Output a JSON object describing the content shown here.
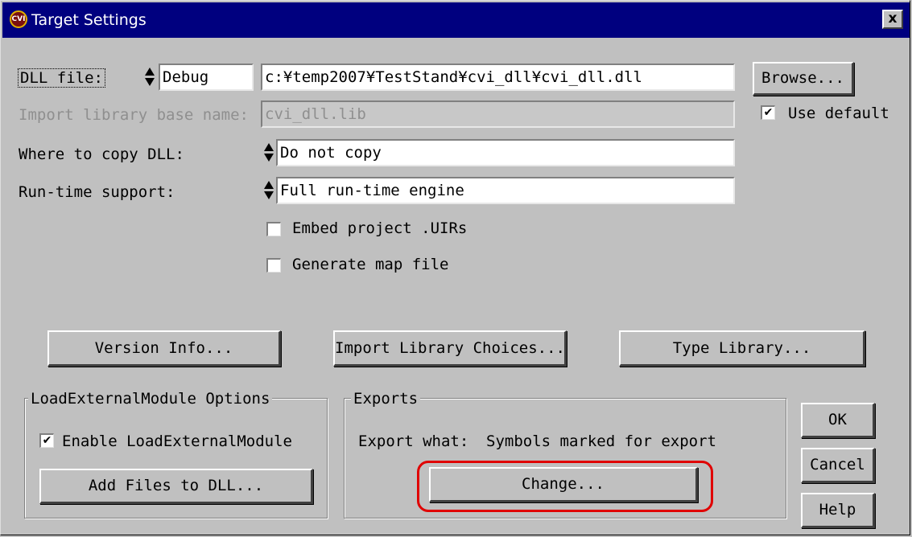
{
  "window": {
    "title": "Target Settings",
    "close_label": "x",
    "icon_text": "CVI"
  },
  "dll_file": {
    "label": "DLL file:",
    "config_value": "Debug",
    "path_value": "c:¥temp2007¥TestStand¥cvi_dll¥cvi_dll.dll",
    "browse_label": "Browse..."
  },
  "import_library": {
    "label": "Import library base name:",
    "value": "cvi_dll.lib",
    "use_default_label": "Use default",
    "use_default_checked": true
  },
  "copy_dll": {
    "label": "Where to copy DLL:",
    "value": "Do not copy"
  },
  "runtime_support": {
    "label": "Run-time support:",
    "value": "Full run-time engine"
  },
  "options": {
    "embed_uirs_label": "Embed project .UIRs",
    "embed_uirs_checked": false,
    "map_file_label": "Generate map file",
    "map_file_checked": false
  },
  "buttons": {
    "version_info": "Version Info...",
    "import_library_choices": "Import Library Choices...",
    "type_library": "Type Library..."
  },
  "load_external": {
    "group_title": "LoadExternalModule Options",
    "enable_label": "Enable LoadExternalModule",
    "enable_checked": true,
    "add_files_label": "Add Files to DLL..."
  },
  "exports": {
    "group_title": "Exports",
    "export_what_label": "Export what:",
    "export_what_value": "Symbols marked for export",
    "change_label": "Change..."
  },
  "dialog_buttons": {
    "ok": "OK",
    "cancel": "Cancel",
    "help": "Help"
  },
  "colors": {
    "titlebar": "#00007f",
    "dialog_bg": "#c0c0c0",
    "highlight": "#e00000"
  }
}
